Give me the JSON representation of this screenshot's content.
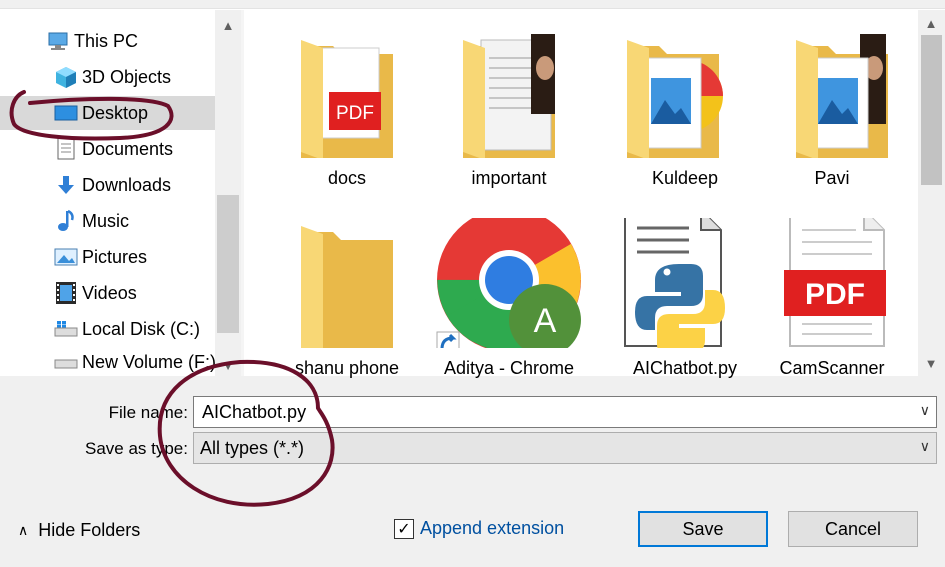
{
  "nav": {
    "items": [
      {
        "label": "This PC",
        "icon": "this-pc-icon"
      },
      {
        "label": "3D Objects",
        "icon": "3d-objects-icon"
      },
      {
        "label": "Desktop",
        "icon": "desktop-icon",
        "selected": true
      },
      {
        "label": "Documents",
        "icon": "documents-icon"
      },
      {
        "label": "Downloads",
        "icon": "downloads-icon"
      },
      {
        "label": "Music",
        "icon": "music-icon"
      },
      {
        "label": "Pictures",
        "icon": "pictures-icon"
      },
      {
        "label": "Videos",
        "icon": "videos-icon"
      },
      {
        "label": "Local Disk (C:)",
        "icon": "local-disk-icon"
      },
      {
        "label": "New Volume (F:)",
        "icon": "new-volume-icon"
      }
    ]
  },
  "files": [
    {
      "name": "docs",
      "type": "folder",
      "overlay": "PDF"
    },
    {
      "name": "important",
      "type": "folder"
    },
    {
      "name": "Kuldeep",
      "type": "folder"
    },
    {
      "name": "Pavi",
      "type": "folder"
    },
    {
      "name": "shanu phone",
      "type": "folder"
    },
    {
      "name": "Aditya - Chrome",
      "type": "shortcut",
      "overlay": "A"
    },
    {
      "name": "AIChatbot.py",
      "type": "python-file"
    },
    {
      "name": "CamScanner",
      "type": "pdf-file",
      "overlay": "PDF"
    }
  ],
  "form": {
    "file_name_label": "File name:",
    "file_name_value": "AIChatbot.py",
    "save_type_label": "Save as type:",
    "save_type_value": "All types (*.*)"
  },
  "footer": {
    "hide_folders": "Hide Folders",
    "append_extension": "Append extension",
    "append_checked": true,
    "save": "Save",
    "cancel": "Cancel"
  },
  "colors": {
    "accent": "#0078d7",
    "annotation": "#6b0f2a",
    "folder": "#f8d775"
  }
}
